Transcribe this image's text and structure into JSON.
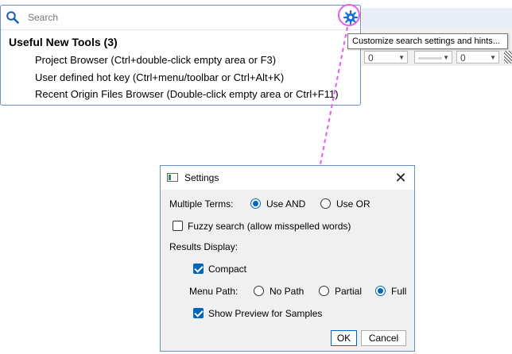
{
  "search": {
    "placeholder": "Search",
    "heading": "Useful New Tools (3)",
    "results": [
      "Project Browser (Ctrl+double-click empty area or F3)",
      "User defined hot key (Ctrl+menu/toolbar or Ctrl+Alt+K)",
      "Recent Origin Files Browser (Double-click empty area or Ctrl+F11)"
    ]
  },
  "tooltip": "Customize search settings and hints...",
  "background_toolbar": {
    "combo1_value": "0",
    "combo3_value": "0"
  },
  "dialog": {
    "title": "Settings",
    "close_glyph": "✕",
    "multiple_terms_label": "Multiple Terms:",
    "use_and_label": "Use AND",
    "use_or_label": "Use OR",
    "multiple_terms_selected": "Use AND",
    "fuzzy_label": "Fuzzy search (allow misspelled words)",
    "fuzzy_checked": false,
    "results_display_label": "Results Display:",
    "compact_label": "Compact",
    "compact_checked": true,
    "menu_path_label": "Menu Path:",
    "no_path_label": "No Path",
    "partial_label": "Partial",
    "full_label": "Full",
    "menu_path_selected": "Full",
    "show_preview_label": "Show Preview for Samples",
    "show_preview_checked": true,
    "ok_label": "OK",
    "cancel_label": "Cancel"
  },
  "colors": {
    "accent": "#0067c0",
    "highlight": "#e85cf0",
    "border": "#6a8fc4"
  }
}
